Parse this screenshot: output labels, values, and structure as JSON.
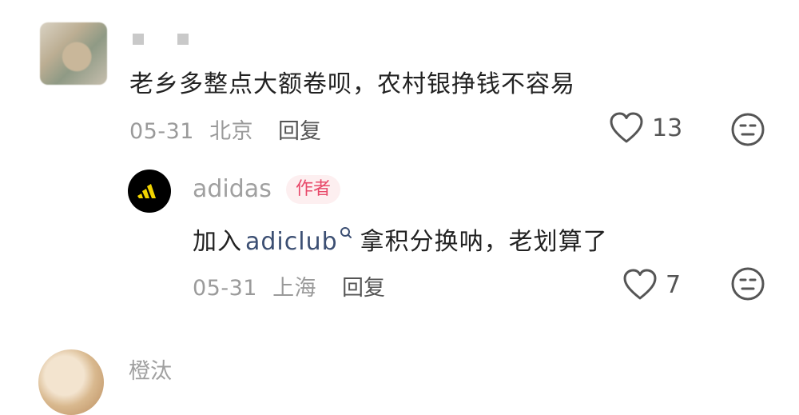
{
  "comment": {
    "text": "老乡多整点大额卷呗，农村银挣钱不容易",
    "date": "05-31",
    "location": "北京",
    "reply_label": "回复",
    "likes": "13"
  },
  "reply": {
    "author": "adidas",
    "badge": "作者",
    "text_before": "加入",
    "link": "adiclub",
    "text_after": "拿积分换呐，老划算了",
    "date": "05-31",
    "location": "上海",
    "reply_label": "回复",
    "likes": "7"
  },
  "next_comment": {
    "username": "橙汰"
  },
  "icons": {
    "like": "heart-outline-icon",
    "emoji": "neutral-face-icon",
    "search": "search-icon",
    "brand": "adidas-logo"
  }
}
